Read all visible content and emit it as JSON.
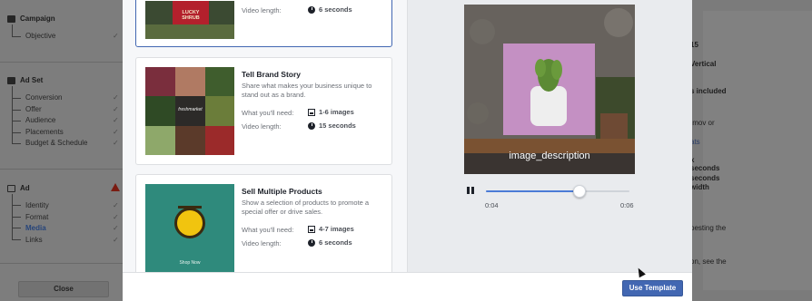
{
  "sidebar": {
    "sections": [
      {
        "title": "Campaign",
        "items": [
          {
            "label": "Objective"
          }
        ]
      },
      {
        "title": "Ad Set",
        "items": [
          {
            "label": "Conversion"
          },
          {
            "label": "Offer"
          },
          {
            "label": "Audience"
          },
          {
            "label": "Placements"
          },
          {
            "label": "Budget & Schedule"
          }
        ]
      },
      {
        "title": "Ad",
        "items": [
          {
            "label": "Identity"
          },
          {
            "label": "Format"
          },
          {
            "label": "Media"
          },
          {
            "label": "Links"
          }
        ]
      }
    ],
    "check_glyph": "✓",
    "close_label": "Close"
  },
  "templates": [
    {
      "thumb_text": [
        "LUCKY",
        "SHRUB"
      ],
      "video_label": "Video length:",
      "video_value": "6 seconds",
      "selected": true
    },
    {
      "title": "Tell Brand Story",
      "description": "Share what makes your business unique to stand out as a brand.",
      "need_label": "What you'll need:",
      "need_value": "1-6 images",
      "video_label": "Video length:",
      "video_value": "15 seconds",
      "thumb_text": "freshmarket"
    },
    {
      "title": "Sell Multiple Products",
      "description": "Show a selection of products to promote a special offer or drive sales.",
      "need_label": "What you'll need:",
      "need_value": "4-7 images",
      "video_label": "Video length:",
      "video_value": "6 seconds",
      "thumb_text": "Shop Now"
    }
  ],
  "preview": {
    "caption": "image_description",
    "time_current": "0:04",
    "time_total": "0:06",
    "progress": 0.65
  },
  "footer": {
    "use_template_label": "Use Template"
  },
  "right_panel": {
    "lines": [
      "15",
      "Vertical",
      "s included",
      ".mov or",
      "ats",
      "x",
      "seconds",
      "seconds",
      "width",
      "pesting the",
      "on, see the"
    ]
  },
  "colors": {
    "accent": "#4267b2",
    "warning": "#7a1c12"
  }
}
